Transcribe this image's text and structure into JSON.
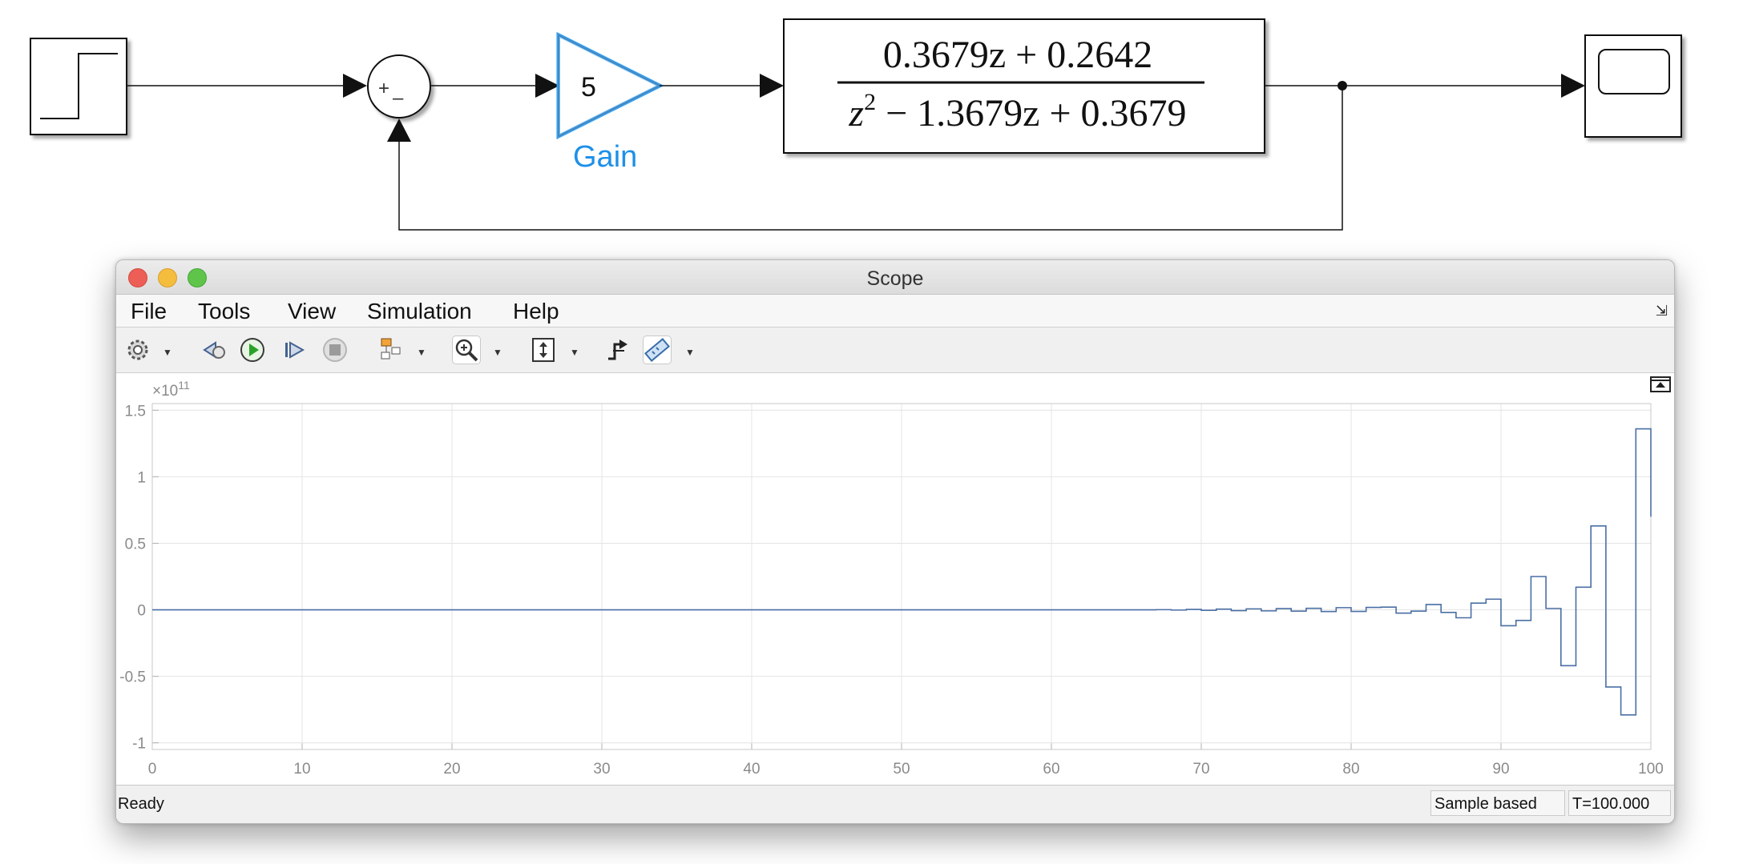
{
  "diagram": {
    "sum_signs": [
      "+",
      "–"
    ],
    "gain": {
      "value": "5",
      "name": "Gain"
    },
    "transfer_fcn": {
      "numerator": "0.3679z + 0.2642",
      "denominator_prefix": "z",
      "denominator_exponent": "2",
      "denominator_rest": " − 1.3679z + 0.3679"
    },
    "accent_color": "#1e90e8"
  },
  "scope": {
    "title": "Scope",
    "menu": [
      "File",
      "Tools",
      "View",
      "Simulation",
      "Help"
    ],
    "toolbar_icons": [
      "settings-icon",
      "step-back-icon",
      "run-icon",
      "step-forward-icon",
      "stop-icon",
      "highlight-block-icon",
      "zoom-in-icon",
      "autoscale-icon",
      "triggers-icon",
      "measurements-icon"
    ],
    "status": {
      "left": "Ready",
      "mode": "Sample based",
      "time": "T=100.000"
    },
    "axis_exponent": "×10",
    "axis_exponent_power": "11"
  },
  "chart_data": {
    "type": "line",
    "step": true,
    "title": "",
    "xlabel": "",
    "ylabel": "",
    "xlim": [
      0,
      100
    ],
    "ylim": [
      -1.05,
      1.55
    ],
    "y_scale_exponent": 11,
    "xticks": [
      0,
      10,
      20,
      30,
      40,
      50,
      60,
      70,
      80,
      90,
      100
    ],
    "yticks": [
      -1,
      -0.5,
      0,
      0.5,
      1,
      1.5
    ],
    "ytick_labels": [
      "-1",
      "-0.5",
      "0",
      "0.5",
      "1",
      "1.5"
    ],
    "grid": true,
    "line_color": "#4a6fa5",
    "series": [
      {
        "x": [
          0,
          66,
          67,
          68,
          69,
          70,
          71,
          72,
          73,
          74,
          75,
          76,
          77,
          78,
          79,
          80,
          81,
          82,
          83,
          84,
          85,
          86,
          87,
          88,
          89,
          90,
          91,
          92,
          93,
          94,
          95,
          96,
          97,
          98,
          99,
          100
        ],
        "y": [
          0,
          0,
          0.001,
          -0.002,
          0.003,
          -0.004,
          0.005,
          -0.006,
          0.007,
          -0.008,
          0.009,
          -0.01,
          0.011,
          -0.013,
          0.016,
          -0.012,
          0.018,
          0.02,
          -0.025,
          -0.01,
          0.04,
          -0.02,
          -0.06,
          0.05,
          0.08,
          -0.12,
          -0.08,
          0.25,
          0.01,
          -0.42,
          0.17,
          0.63,
          -0.58,
          -0.79,
          1.36,
          0.7
        ]
      }
    ]
  }
}
